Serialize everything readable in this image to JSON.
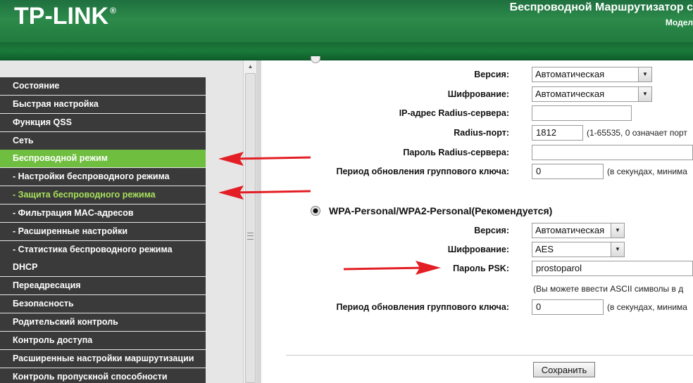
{
  "header": {
    "logo": "TP-LINK",
    "logo_reg": "®",
    "title": "Беспроводной Маршрутизатор с",
    "subtitle": "Модел"
  },
  "sidebar": {
    "items": [
      {
        "label": "Состояние"
      },
      {
        "label": "Быстрая настройка"
      },
      {
        "label": "Функция QSS"
      },
      {
        "label": "Сеть"
      },
      {
        "label": "Беспроводной режим",
        "active": true
      },
      {
        "label": "- Настройки беспроводного режима"
      },
      {
        "label": "- Защита беспроводного режима",
        "sub_active": true
      },
      {
        "label": "- Фильтрация MAC-адресов"
      },
      {
        "label": "- Расширенные настройки"
      },
      {
        "label": "- Статистика беспроводного режима"
      },
      {
        "label": "DHCP"
      },
      {
        "label": "Переадресация"
      },
      {
        "label": "Безопасность"
      },
      {
        "label": "Родительский контроль"
      },
      {
        "label": "Контроль доступа"
      },
      {
        "label": "Расширенные настройки маршрутизации"
      },
      {
        "label": "Контроль пропускной способности"
      }
    ],
    "active_color": "#6fbe3f",
    "sub_active_color": "#a8e05c",
    "item_color": "#3a3a3a"
  },
  "enterprise": {
    "version_label": "Версия:",
    "version_value": "Автоматическая",
    "encryption_label": "Шифрование:",
    "encryption_value": "Автоматическая",
    "radius_ip_label": "IP-адрес Radius-сервера:",
    "radius_ip_value": "",
    "radius_port_label": "Radius-порт:",
    "radius_port_value": "1812",
    "radius_port_hint": "(1-65535, 0 означает порт",
    "radius_password_label": "Пароль Radius-сервера:",
    "radius_password_value": "",
    "group_key_label": "Период обновления группового ключа:",
    "group_key_value": "0",
    "group_key_hint": "(в секундах, минима"
  },
  "personal": {
    "title": "WPA-Personal/WPA2-Personal(Рекомендуется)",
    "version_label": "Версия:",
    "version_value": "Автоматическая",
    "encryption_label": "Шифрование:",
    "encryption_value": "AES",
    "psk_label": "Пароль PSK:",
    "psk_value": "prostoparol",
    "psk_hint": "(Вы можете ввести ASCII символы в д",
    "group_key_label": "Период обновления группового ключа:",
    "group_key_value": "0",
    "group_key_hint": "(в секундах, минима"
  },
  "actions": {
    "save_label": "Сохранить"
  },
  "annotations": {
    "arrow_color": "#e31e24"
  }
}
